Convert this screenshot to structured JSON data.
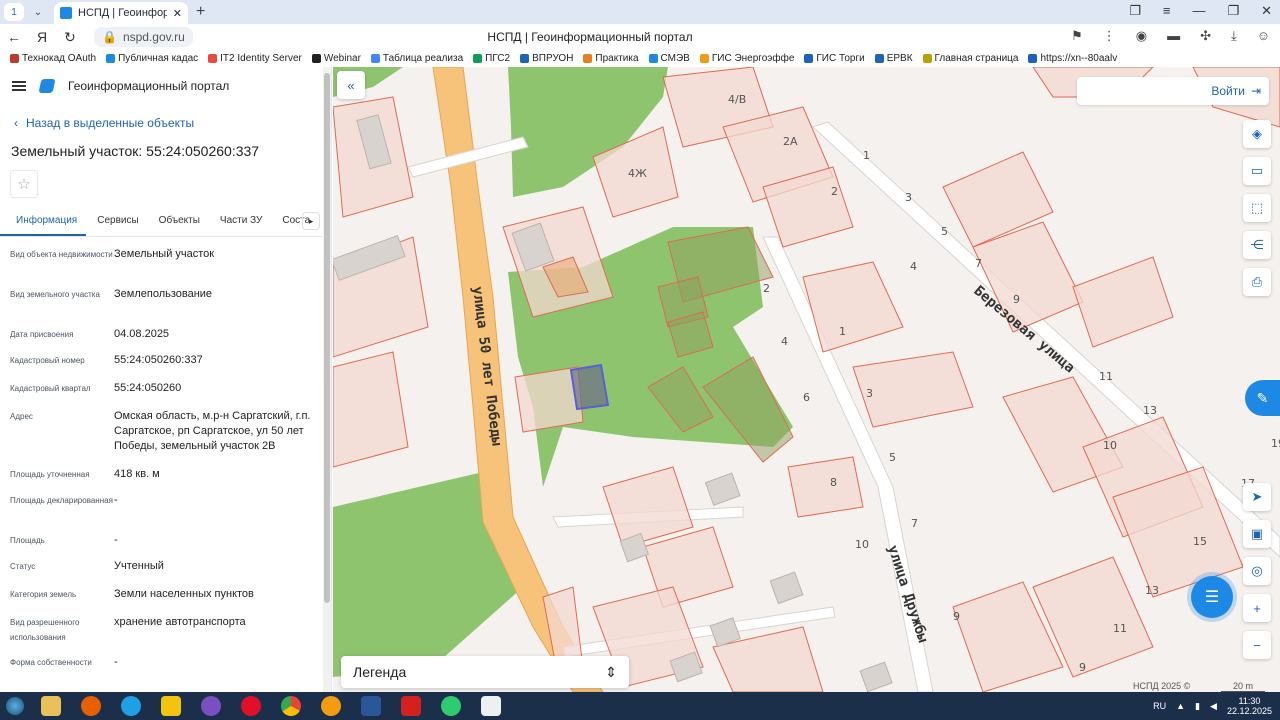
{
  "browser": {
    "tab_number": "1",
    "tab_title": "НСПД | Геоинформацион",
    "url": "nspd.gov.ru",
    "page_title": "НСПД | Геоинформационный портал",
    "bookmarks": [
      "Технокад OAuth",
      "Публичная кадас",
      "IT2 Identity Server",
      "Webinar",
      "Таблица реализа",
      "ПГС2",
      "ВПРУОН",
      "Практика",
      "СМЭВ",
      "ГИС Энергоэффе",
      "ГИС Торги",
      "ЕРВК",
      "Главная страница",
      "https://xn--80aalv"
    ],
    "bookmark_colors": [
      "#c0392b",
      "#1e88e5",
      "#e74c3c",
      "#222222",
      "#4285f4",
      "#0f9d58",
      "#1e63b5",
      "#e67e22",
      "#1e88e5",
      "#f39c12",
      "#1e63b5",
      "#1e63b5",
      "#c0a000",
      "#1e63b5",
      "#2c3e50"
    ]
  },
  "sidebar": {
    "app_title": "Геоинформационный портал",
    "back_label": "Назад в выделенные объекты",
    "object_title": "Земельный участок: 55:24:050260:337",
    "tabs": [
      "Информация",
      "Сервисы",
      "Объекты",
      "Части ЗУ",
      "Соста"
    ],
    "properties": [
      {
        "key": "Вид объекта недвижимости",
        "value": "Земельный участок"
      },
      {
        "key": "Вид земельного участка",
        "value": "Землепользование"
      },
      {
        "key": "Дата присвоения",
        "value": "04.08.2025"
      },
      {
        "key": "Кадастровый номер",
        "value": "55:24:050260:337"
      },
      {
        "key": "Кадастровый квартал",
        "value": "55:24:050260"
      },
      {
        "key": "Адрес",
        "value": "Омская область, м.р-н Саргатский, г.п. Саргатское, рп Саргатское, ул 50 лет Победы, земельный участок 2В"
      },
      {
        "key": "Площадь уточненная",
        "value": "418 кв. м"
      },
      {
        "key": "Площадь декларированная",
        "value": "-"
      },
      {
        "key": "Площадь",
        "value": "-"
      },
      {
        "key": "Статус",
        "value": "Учтенный"
      },
      {
        "key": "Категория земель",
        "value": "Земли населенных пунктов"
      },
      {
        "key": "Вид разрешенного использования",
        "value": "хранение автотранспорта"
      },
      {
        "key": "Форма собственности",
        "value": "-"
      }
    ]
  },
  "map": {
    "login_label": "Войти",
    "legend_label": "Легенда",
    "attribution": "НСПД 2025 ©",
    "scale_label": "20 m",
    "street_labels": [
      "улица 50 лет Победы",
      "улица Дружбы",
      "Березовая улица"
    ],
    "house_numbers": [
      "4/В",
      "2А",
      "1",
      "3",
      "5",
      "2",
      "7",
      "4",
      "9",
      "2",
      "4Ж",
      "1",
      "4",
      "6",
      "3",
      "11",
      "13",
      "10",
      "19",
      "5",
      "8",
      "7",
      "10",
      "17",
      "15",
      "13",
      "9",
      "11",
      "9"
    ],
    "colors": {
      "greenery": "#8fc46f",
      "parcel_stroke": "#e06a52",
      "parcel_fill": "#f3d8d0",
      "road": "#f7c37a",
      "selected": "#5a5fd6"
    }
  },
  "taskbar": {
    "lang": "RU",
    "time": "11:30",
    "date": "22.12.2025"
  }
}
